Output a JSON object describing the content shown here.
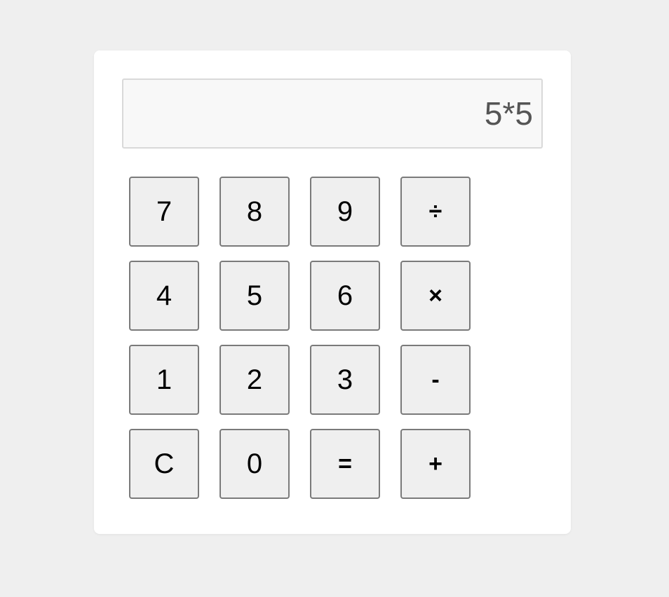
{
  "display": {
    "value": "5*5"
  },
  "keys": [
    {
      "label": "7"
    },
    {
      "label": "8"
    },
    {
      "label": "9"
    },
    {
      "label": "÷"
    },
    {
      "label": "4"
    },
    {
      "label": "5"
    },
    {
      "label": "6"
    },
    {
      "label": "×"
    },
    {
      "label": "1"
    },
    {
      "label": "2"
    },
    {
      "label": "3"
    },
    {
      "label": "-"
    },
    {
      "label": "C"
    },
    {
      "label": "0"
    },
    {
      "label": "="
    },
    {
      "label": "+"
    }
  ],
  "colors": {
    "page_background": "#efefef",
    "panel_background": "#ffffff",
    "display_background": "#f8f8f8",
    "display_text": "#555555",
    "key_background": "#efefef",
    "key_border": "#7a7a7a"
  }
}
